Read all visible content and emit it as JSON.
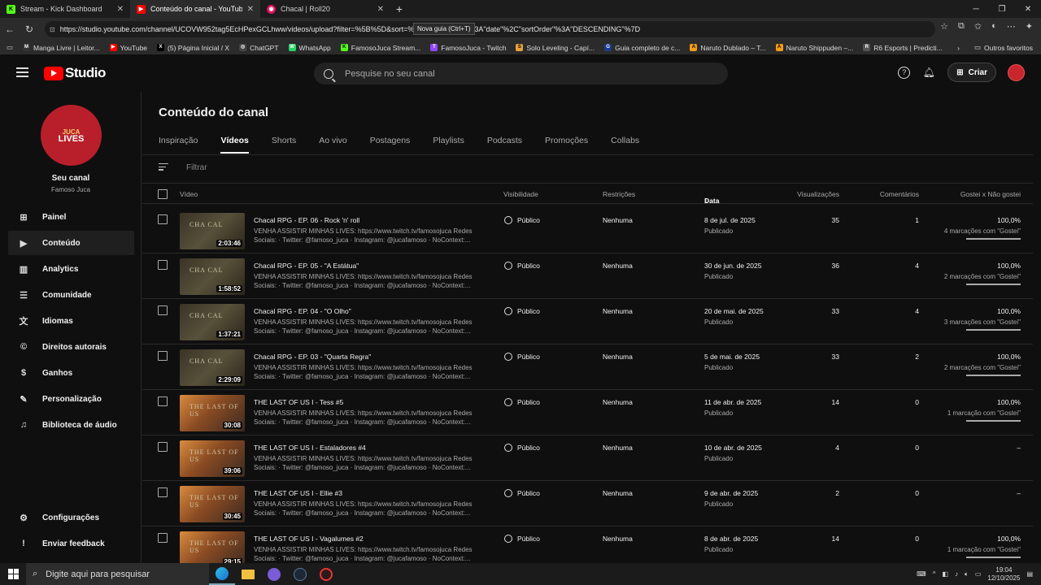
{
  "browser": {
    "tabs": [
      {
        "title": "Stream - Kick Dashboard",
        "color": "#53fc18",
        "glyph": "K"
      },
      {
        "title": "Conteúdo do canal - YouTube Stu",
        "color": "#ff0000",
        "glyph": "▶"
      },
      {
        "title": "Chacal | Roll20",
        "color": "#e0115f",
        "glyph": "◉"
      }
    ],
    "newtab_tooltip": "Nova guia (Ctrl+T)",
    "url": "https://studio.youtube.com/channel/UCOVW952tag5EcHPexGCLhww/videos/upload?filter=%5B%5D&sort=%7B\"columnType\"%3A\"date\"%2C\"sortOrder\"%3A\"DESCENDING\"%7D",
    "bookmarks": [
      {
        "label": "Manga Livre | Leitor...",
        "color": "#333",
        "glyph": "M"
      },
      {
        "label": "YouTube",
        "color": "#ff0000",
        "glyph": "▶"
      },
      {
        "label": "(5) Página Inicial / X",
        "color": "#000",
        "glyph": "X"
      },
      {
        "label": "ChatGPT",
        "color": "#444",
        "glyph": "◎"
      },
      {
        "label": "WhatsApp",
        "color": "#25d366",
        "glyph": "W"
      },
      {
        "label": "FamosoJuca Stream...",
        "color": "#53fc18",
        "glyph": "K"
      },
      {
        "label": "FamosoJuca - Twitch",
        "color": "#9146ff",
        "glyph": "T"
      },
      {
        "label": "Solo Leveling - Capí...",
        "color": "#e6a23c",
        "glyph": "S"
      },
      {
        "label": "Guia completo de c...",
        "color": "#1a3c8c",
        "glyph": "G"
      },
      {
        "label": "Naruto Dublado – T...",
        "color": "#f39c12",
        "glyph": "A"
      },
      {
        "label": "Naruto Shippuden –...",
        "color": "#f39c12",
        "glyph": "A"
      },
      {
        "label": "R6 Esports | Predicti...",
        "color": "#555",
        "glyph": "R"
      }
    ],
    "other_bookmarks": "Outros favoritos"
  },
  "header": {
    "logo_text": "Studio",
    "search_placeholder": "Pesquise no seu canal",
    "create_label": "Criar"
  },
  "channel": {
    "avatar_text_1": "JUCA",
    "avatar_text_2": "LIVES",
    "name": "Seu canal",
    "handle": "Famoso Juca"
  },
  "sidebar": {
    "items": [
      {
        "label": "Painel",
        "icon": "⊞"
      },
      {
        "label": "Conteúdo",
        "icon": "▶"
      },
      {
        "label": "Analytics",
        "icon": "▥"
      },
      {
        "label": "Comunidade",
        "icon": "☰"
      },
      {
        "label": "Idiomas",
        "icon": "文"
      },
      {
        "label": "Direitos autorais",
        "icon": "©"
      },
      {
        "label": "Ganhos",
        "icon": "$"
      },
      {
        "label": "Personalização",
        "icon": "✎"
      },
      {
        "label": "Biblioteca de áudio",
        "icon": "♫"
      }
    ],
    "settings": "Configurações",
    "feedback": "Enviar feedback"
  },
  "main": {
    "title": "Conteúdo do canal",
    "tabs": [
      "Inspiração",
      "Vídeos",
      "Shorts",
      "Ao vivo",
      "Postagens",
      "Playlists",
      "Podcasts",
      "Promoções",
      "Collabs"
    ],
    "filter_placeholder": "Filtrar",
    "columns": {
      "video": "Vídeo",
      "visibility": "Visibilidade",
      "restrictions": "Restrições",
      "date": "Data",
      "views": "Visualizações",
      "comments": "Comentários",
      "likes": "Gostei x Não gostei"
    }
  },
  "videos": [
    {
      "title": "Chacal RPG - EP. 06 - Rock 'n' roll",
      "duration": "2:03:46",
      "visibility": "Público",
      "restrictions": "Nenhuma",
      "date": "8 de jul. de 2025",
      "status": "Publicado",
      "views": "35",
      "comments": "1",
      "likes": "100,0%",
      "likes_sub": "4 marcações com \"Gostei\"",
      "thumb": "CHA  CAL",
      "style": "dark"
    },
    {
      "title": "Chacal RPG - EP. 05 - \"A Estátua\"",
      "duration": "1:58:52",
      "visibility": "Público",
      "restrictions": "Nenhuma",
      "date": "30 de jun. de 2025",
      "status": "Publicado",
      "views": "36",
      "comments": "4",
      "likes": "100,0%",
      "likes_sub": "2 marcações com \"Gostei\"",
      "thumb": "CHA  CAL",
      "style": "dark"
    },
    {
      "title": "Chacal RPG - EP. 04 - \"O Olho\"",
      "duration": "1:37:21",
      "visibility": "Público",
      "restrictions": "Nenhuma",
      "date": "20 de mai. de 2025",
      "status": "Publicado",
      "views": "33",
      "comments": "4",
      "likes": "100,0%",
      "likes_sub": "3 marcações com \"Gostei\"",
      "thumb": "CHA  CAL",
      "style": "dark"
    },
    {
      "title": "Chacal RPG - EP. 03 - \"Quarta Regra\"",
      "duration": "2:29:09",
      "visibility": "Público",
      "restrictions": "Nenhuma",
      "date": "5 de mai. de 2025",
      "status": "Publicado",
      "views": "33",
      "comments": "2",
      "likes": "100,0%",
      "likes_sub": "2 marcações com \"Gostei\"",
      "thumb": "CHA  CAL",
      "style": "dark"
    },
    {
      "title": "THE LAST OF US I - Tess #5",
      "duration": "30:08",
      "visibility": "Público",
      "restrictions": "Nenhuma",
      "date": "11 de abr. de 2025",
      "status": "Publicado",
      "views": "14",
      "comments": "0",
      "likes": "100,0%",
      "likes_sub": "1 marcação com \"Gostei\"",
      "thumb": "THE LAST OF US",
      "style": "warm"
    },
    {
      "title": "THE LAST OF US I - Estaladores #4",
      "duration": "39:06",
      "visibility": "Público",
      "restrictions": "Nenhuma",
      "date": "10 de abr. de 2025",
      "status": "Publicado",
      "views": "4",
      "comments": "0",
      "likes": "–",
      "likes_sub": "",
      "thumb": "THE LAST OF US",
      "style": "warm"
    },
    {
      "title": "THE LAST OF US I - Ellie #3",
      "duration": "30:45",
      "visibility": "Público",
      "restrictions": "Nenhuma",
      "date": "9 de abr. de 2025",
      "status": "Publicado",
      "views": "2",
      "comments": "0",
      "likes": "–",
      "likes_sub": "",
      "thumb": "THE LAST OF US",
      "style": "warm"
    },
    {
      "title": "THE LAST OF US I - Vagalumes #2",
      "duration": "29:15",
      "visibility": "Público",
      "restrictions": "Nenhuma",
      "date": "8 de abr. de 2025",
      "status": "Publicado",
      "views": "14",
      "comments": "0",
      "likes": "100,0%",
      "likes_sub": "1 marcação com \"Gostei\"",
      "thumb": "THE LAST OF US",
      "style": "warm"
    }
  ],
  "video_description": "VENHA ASSISTIR MINHAS LIVES: https://www.twitch.tv/famosojuca Redes Sociais: · Twitter: @famoso_juca · Instagram: @jucafamoso · NoContext:...",
  "taskbar": {
    "search_placeholder": "Digite aqui para pesquisar",
    "time": "19:04",
    "date": "12/10/2025"
  }
}
